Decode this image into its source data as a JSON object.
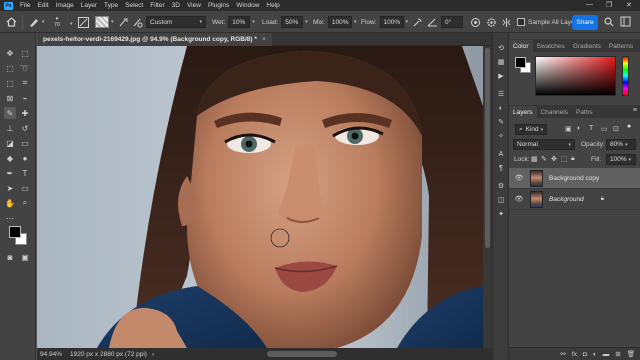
{
  "menubar": {
    "app_logo": "Ps",
    "items": [
      "File",
      "Edit",
      "Image",
      "Layer",
      "Type",
      "Select",
      "Filter",
      "3D",
      "View",
      "Plugins",
      "Window",
      "Help"
    ],
    "window_controls": [
      "—",
      "❐",
      "✕"
    ]
  },
  "options": {
    "brush_size": "70",
    "mode": "Custom",
    "wet_label": "Wet:",
    "wet": "10%",
    "load_label": "Load:",
    "load": "50%",
    "mix_label": "Mix:",
    "mix": "100%",
    "flow_label": "Flow:",
    "flow": "100%",
    "angle": "0°",
    "sample_all_label": "Sample All Laye",
    "share_label": "Share"
  },
  "document": {
    "tab_title": "pexels-heitor-verdi-2169429.jpg @ 94.9% (Background copy, RGB/8) *",
    "close": "×"
  },
  "status": {
    "zoom": "94.94%",
    "dimensions": "1920 px x 2880 px (72 ppi)",
    "arrow": "›"
  },
  "color_panel": {
    "tabs": [
      "Color",
      "Swatches",
      "Gradients",
      "Patterns"
    ],
    "active_tab": "Color",
    "foreground_color": "#000000",
    "background_color": "#ffffff"
  },
  "layers_panel": {
    "tabs": [
      "Layers",
      "Channels",
      "Paths"
    ],
    "active_tab": "Layers",
    "filter_kind": "Kind",
    "blend_mode": "Normal",
    "opacity_label": "Opacity:",
    "opacity": "80%",
    "lock_label": "Lock:",
    "fill_label": "Fill:",
    "fill": "100%",
    "layers": [
      {
        "name": "Background copy",
        "selected": true,
        "locked": false
      },
      {
        "name": "Background",
        "selected": false,
        "locked": true
      }
    ],
    "footer_icons": [
      "link-icon",
      "fx-icon",
      "mask-icon",
      "adjustment-icon",
      "folder-icon",
      "new-layer-icon",
      "trash-icon"
    ]
  }
}
